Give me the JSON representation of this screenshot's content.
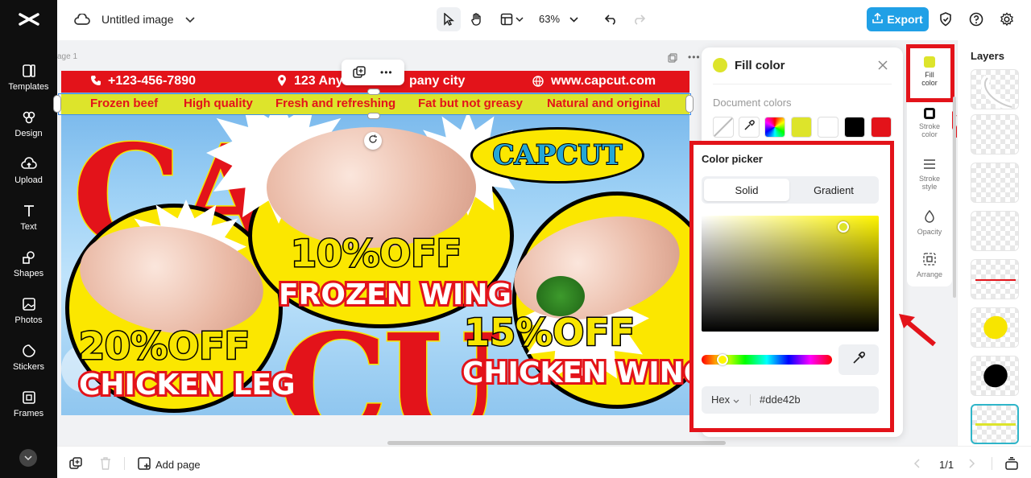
{
  "sidebar": {
    "items": [
      {
        "label": "Templates",
        "icon": "templates-icon"
      },
      {
        "label": "Design",
        "icon": "design-icon"
      },
      {
        "label": "Upload",
        "icon": "upload-icon"
      },
      {
        "label": "Text",
        "icon": "text-icon"
      },
      {
        "label": "Shapes",
        "icon": "shapes-icon"
      },
      {
        "label": "Photos",
        "icon": "photos-icon"
      },
      {
        "label": "Stickers",
        "icon": "stickers-icon"
      },
      {
        "label": "Frames",
        "icon": "frames-icon"
      }
    ]
  },
  "header": {
    "title": "Untitled image",
    "zoom": "63%",
    "export_label": "Export",
    "accent": "#20a0e6"
  },
  "canvas": {
    "page_label": "age 1",
    "contact": {
      "phone": "+123-456-7890",
      "address": "123 Any",
      "address_tail": "pany city",
      "web": "www.capcut.com"
    },
    "features": [
      "Frozen beef",
      "High quality",
      "Fresh and refreshing",
      "Fat but not greasy",
      "Natural and original"
    ],
    "brand": "CAPCUT",
    "promos": [
      {
        "pct": "10%OFF",
        "item": "FROZEN WING"
      },
      {
        "pct": "20%OFF",
        "item": "CHICKEN LEG"
      },
      {
        "pct": "15%OFF",
        "item": "CHICKEN WING"
      }
    ]
  },
  "fill_panel": {
    "title": "Fill color",
    "current_color": "#dde42b",
    "doc_colors_label": "Document colors",
    "doc_colors": [
      "#dde42b",
      "#ffffff",
      "#000000",
      "#e3131a"
    ],
    "picker": {
      "title": "Color picker",
      "tab_solid": "Solid",
      "tab_gradient": "Gradient",
      "format": "Hex",
      "hex": "#dde42b",
      "hue_fraction": 0.16,
      "saturation": 0.8,
      "brightness": 0.9
    }
  },
  "prop_tabs": [
    {
      "label": "Fill color",
      "icon": "fill-icon"
    },
    {
      "label": "Stroke color",
      "icon": "stroke-color-icon"
    },
    {
      "label": "Stroke style",
      "icon": "stroke-style-icon"
    },
    {
      "label": "Opacity",
      "icon": "opacity-icon"
    },
    {
      "label": "Arrange",
      "icon": "arrange-icon"
    }
  ],
  "layers": {
    "title": "Layers"
  },
  "footer": {
    "add_page": "Add page",
    "page_indicator": "1/1"
  },
  "highlight_color": "#e3131a"
}
